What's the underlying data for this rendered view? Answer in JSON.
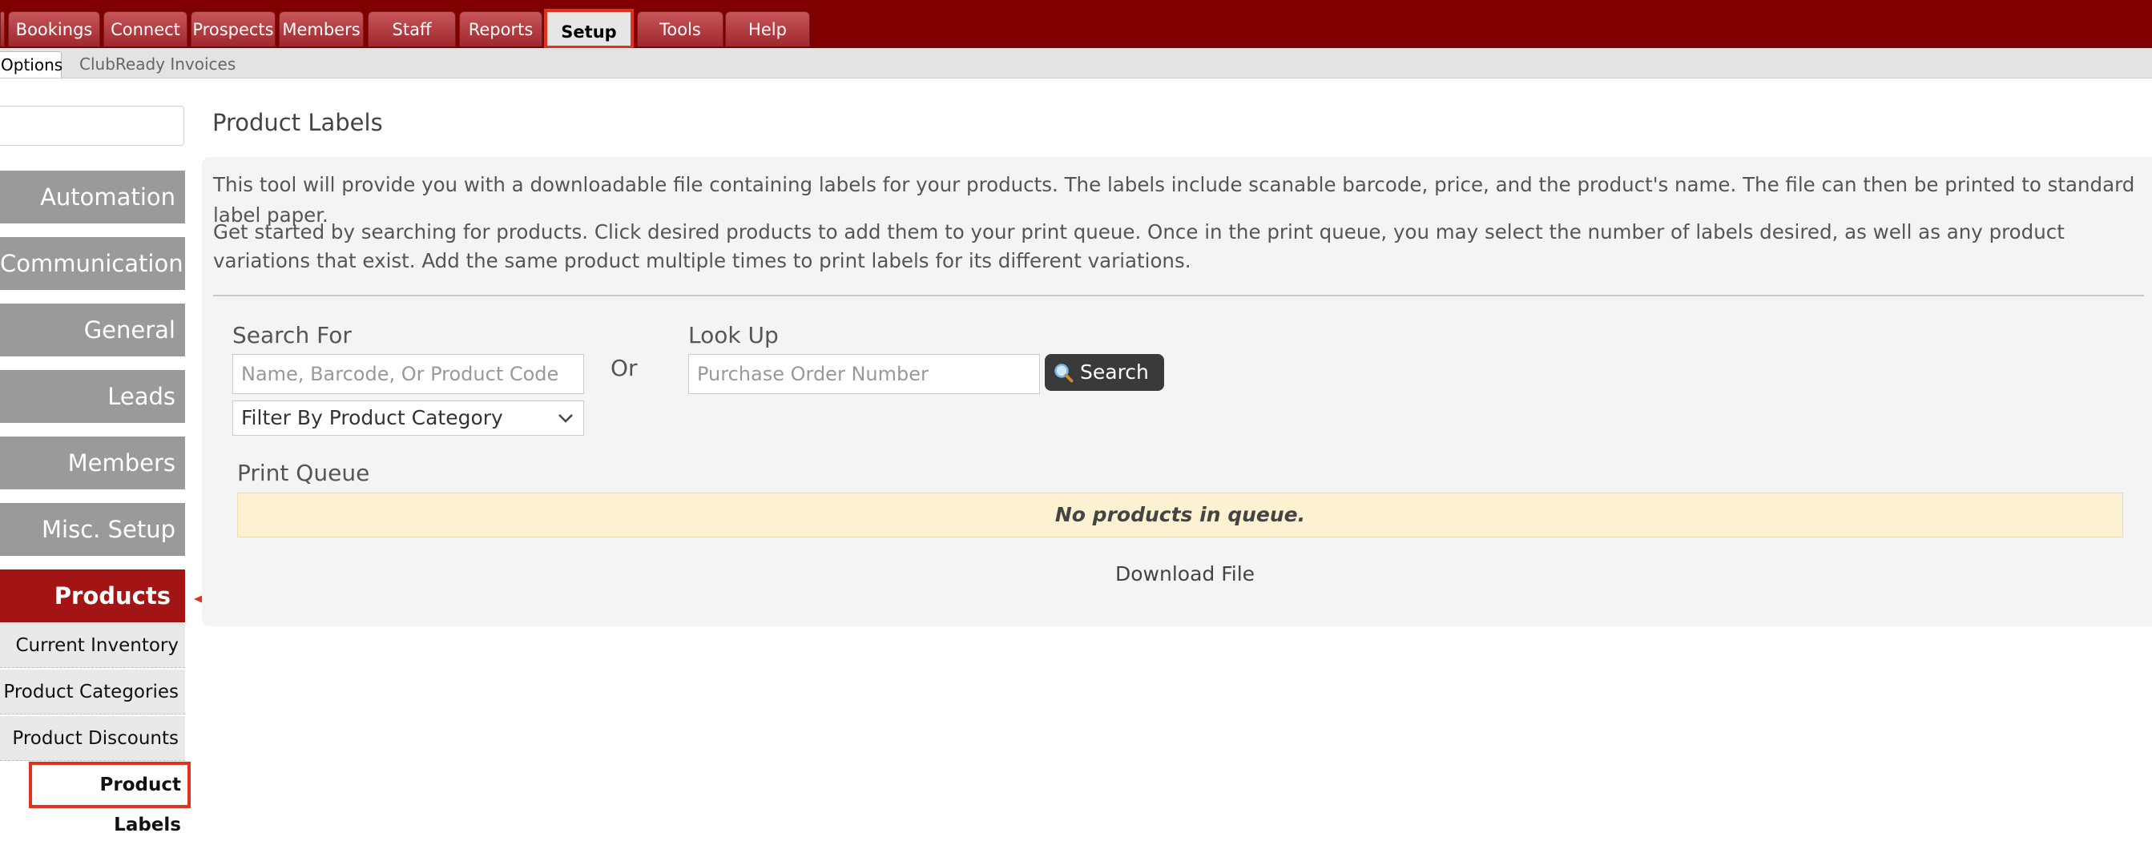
{
  "nav": {
    "tabs": [
      "Bookings",
      "Connect",
      "Prospects",
      "Members",
      "Staff",
      "Reports",
      "Setup",
      "Tools",
      "Help"
    ],
    "active": "Setup"
  },
  "subnav": {
    "tabs": [
      "Options",
      "ClubReady Invoices"
    ]
  },
  "sidebar": {
    "sections": [
      "Automation",
      "Communication",
      "General",
      "Leads",
      "Members",
      "Misc. Setup",
      "Products"
    ],
    "sub_items": [
      "Current Inventory",
      "Product Categories",
      "Product Discounts",
      "Product Labels"
    ]
  },
  "main": {
    "title": "Product Labels",
    "intro_1": "This tool will provide you with a downloadable file containing labels for your products. The labels include scanable barcode, price, and the product's name. The file can then be printed to standard label paper.",
    "intro_2": "Get started by searching for products. Click desired products to add them to your print queue. Once in the print queue, you may select the number of labels desired, as well as any product variations that exist. Add the same product multiple times to print labels for its different variations.",
    "search_for_label": "Search For",
    "search_placeholder": "Name, Barcode, Or Product Code",
    "category_filter": "Filter By Product Category",
    "or_label": "Or",
    "lookup_label": "Look Up",
    "lookup_placeholder": "Purchase Order Number",
    "search_button": "Search",
    "print_queue_label": "Print Queue",
    "queue_empty": "No products in queue.",
    "download": "Download File"
  },
  "colors": {
    "brand": "#800000",
    "active_section": "#a31515",
    "highlight": "#e0321f",
    "queue_bg": "#fcf1d1"
  }
}
